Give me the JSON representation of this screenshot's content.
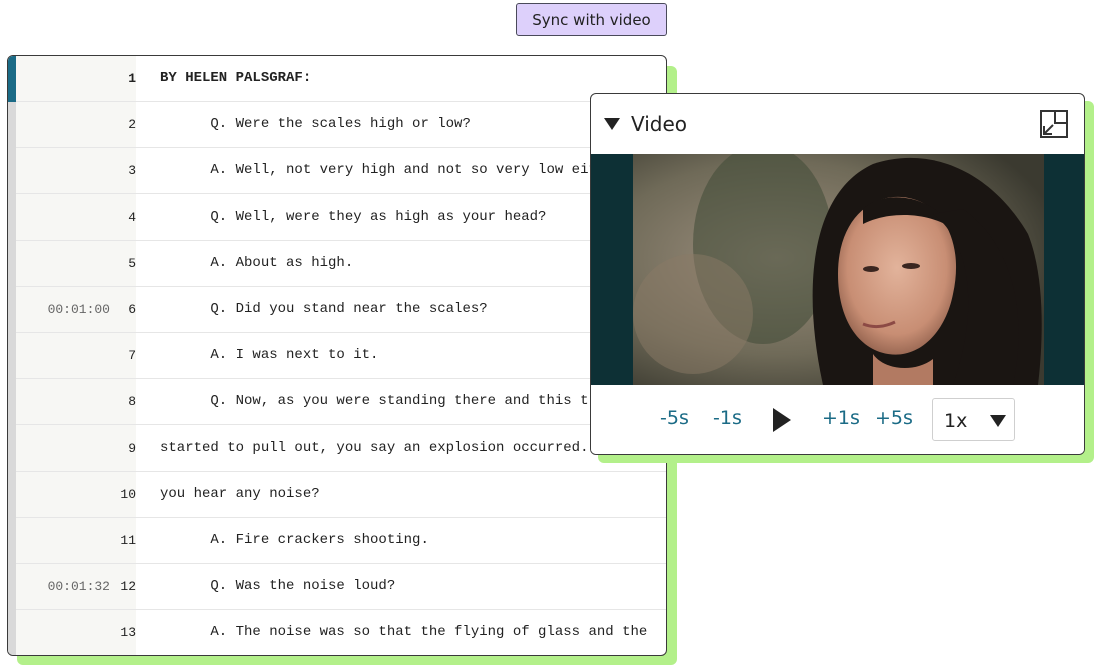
{
  "toolbar": {
    "sync_label": "Sync with video"
  },
  "transcript": {
    "lines": [
      {
        "num": "1",
        "ts": "",
        "text": "BY HELEN PALSGRAF:"
      },
      {
        "num": "2",
        "ts": "",
        "text": "      Q. Were the scales high or low?"
      },
      {
        "num": "3",
        "ts": "",
        "text": "      A. Well, not very high and not so very low eit"
      },
      {
        "num": "4",
        "ts": "",
        "text": "      Q. Well, were they as high as your head?"
      },
      {
        "num": "5",
        "ts": "",
        "text": "      A. About as high."
      },
      {
        "num": "6",
        "ts": "00:01:00",
        "text": "      Q. Did you stand near the scales?"
      },
      {
        "num": "7",
        "ts": "",
        "text": "      A. I was next to it."
      },
      {
        "num": "8",
        "ts": "",
        "text": "      Q. Now, as you were standing there and this tr"
      },
      {
        "num": "9",
        "ts": "",
        "text": "started to pull out, you say an explosion occurred."
      },
      {
        "num": "10",
        "ts": "",
        "text": "you hear any noise?"
      },
      {
        "num": "11",
        "ts": "",
        "text": "      A. Fire crackers shooting."
      },
      {
        "num": "12",
        "ts": "00:01:32",
        "text": "      Q. Was the noise loud?"
      },
      {
        "num": "13",
        "ts": "",
        "text": "      A. The noise was so that the flying of glass and the"
      }
    ]
  },
  "video": {
    "title": "Video",
    "controls": {
      "back5": "-5s",
      "back1": "-1s",
      "fwd1": "+1s",
      "fwd5": "+5s",
      "speed": "1x"
    },
    "icons": {
      "collapse": "triangle-down-icon",
      "expand": "expand-icon",
      "play": "play-icon",
      "speed_caret": "chevron-down-icon"
    }
  },
  "colors": {
    "accent": "#1b6b86",
    "shadow": "#b3f08a",
    "sync_bg": "#ddd0fb",
    "video_bg": "#0d3035"
  }
}
